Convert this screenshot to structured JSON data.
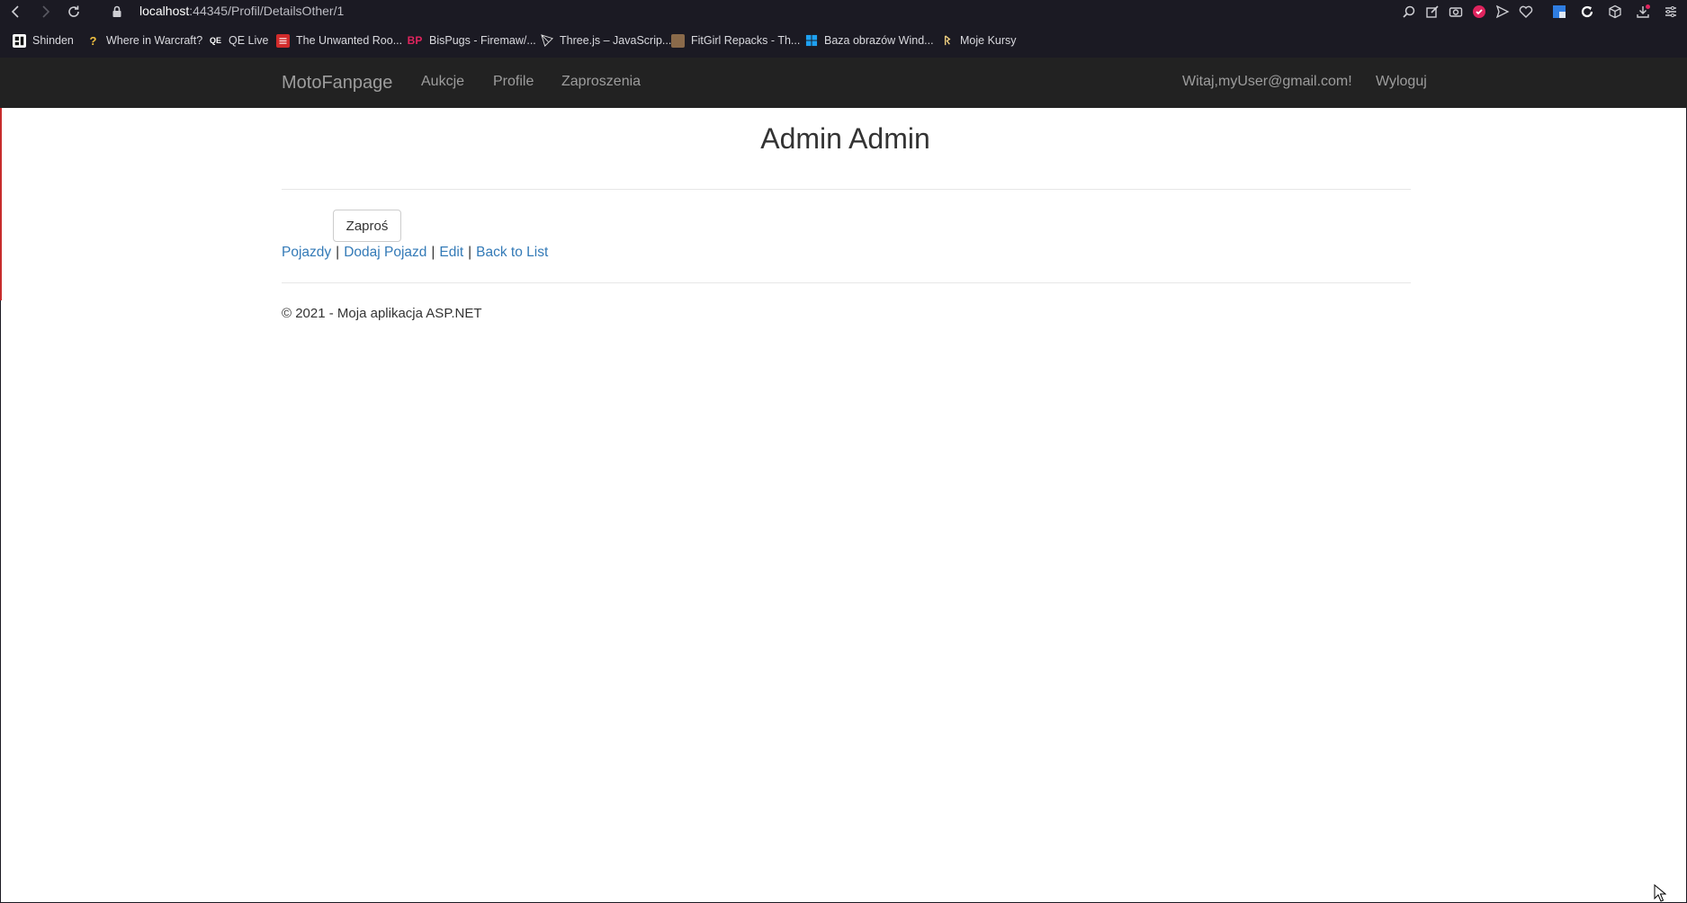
{
  "browser": {
    "url_host": "localhost",
    "url_rest": ":44345/Profil/DetailsOther/1",
    "bookmarks": [
      {
        "label": "Shinden",
        "icon": "shinden-icon"
      },
      {
        "label": "Where in Warcraft?",
        "icon": "question-icon"
      },
      {
        "label": "QE Live",
        "icon": "qe-icon"
      },
      {
        "label": "The Unwanted Roo...",
        "icon": "unwanted-icon"
      },
      {
        "label": "BisPugs - Firemaw/...",
        "icon": "bp-icon"
      },
      {
        "label": "Three.js – JavaScrip...",
        "icon": "threejs-icon"
      },
      {
        "label": "FitGirl Repacks - Th...",
        "icon": "fitgirl-icon"
      },
      {
        "label": "Baza obrazów Wind...",
        "icon": "windows-icon"
      },
      {
        "label": "Moje Kursy",
        "icon": "kursy-icon"
      }
    ],
    "bookmark_icon_text": {
      "bp": "BP",
      "question": "?",
      "qe": "QE"
    }
  },
  "navbar": {
    "brand": "MotoFanpage",
    "links": [
      "Aukcje",
      "Profile",
      "Zaproszenia"
    ],
    "greeting": "Witaj,myUser@gmail.com!",
    "logout": "Wyloguj"
  },
  "main": {
    "title": "Admin Admin",
    "invite_button": "Zaproś",
    "links": [
      "Pojazdy",
      "Dodaj Pojazd",
      "Edit",
      "Back to List"
    ],
    "separator": "|"
  },
  "footer": {
    "text": "© 2021 - Moja aplikacja ASP.NET"
  }
}
